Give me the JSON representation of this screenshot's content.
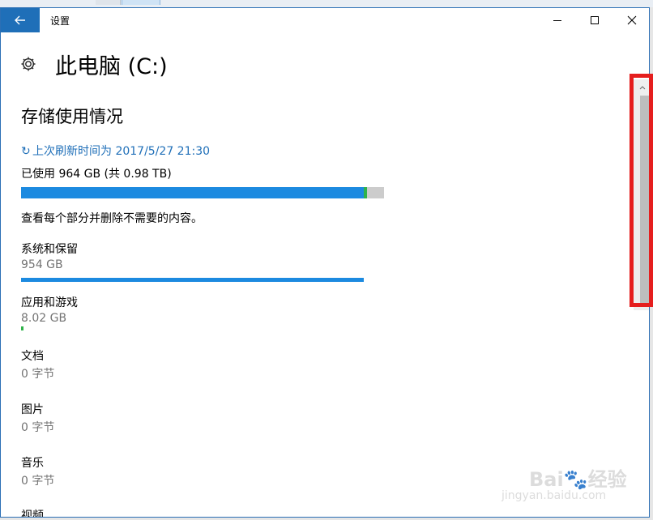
{
  "titlebar": {
    "title": "设置"
  },
  "page": {
    "title": "此电脑 (C:)"
  },
  "storage": {
    "section_title": "存储使用情况",
    "refresh_link": "上次刷新时间为 2017/5/27 21:30",
    "used_summary": "已使用 964 GB (共 0.98 TB)",
    "usage_fraction": 0.98,
    "hint": "查看每个部分并删除不需要的内容。",
    "categories": [
      {
        "name": "系统和保留",
        "size": "954 GB",
        "fraction": 0.944,
        "color": "#1c8ae0"
      },
      {
        "name": "应用和游戏",
        "size": "8.02 GB",
        "fraction": 0.008,
        "color": "#2fb34a"
      },
      {
        "name": "文档",
        "size": "0 字节",
        "fraction": 0
      },
      {
        "name": "图片",
        "size": "0 字节",
        "fraction": 0
      },
      {
        "name": "音乐",
        "size": "0 字节",
        "fraction": 0
      },
      {
        "name": "视频"
      }
    ]
  },
  "icons": {
    "back": "back-arrow-icon",
    "gear": "gear-icon",
    "refresh": "refresh-icon",
    "minimize": "minimize-icon",
    "maximize": "maximize-icon",
    "close": "close-icon",
    "scroll_up": "chevron-up-icon"
  },
  "watermark": {
    "brand": "Bai",
    "brand_cn": "经验",
    "url": "jingyan.baidu.com"
  },
  "colors": {
    "accent": "#1f6fb8",
    "system_bar": "#1c8ae0",
    "apps_bar": "#2fb34a",
    "highlight": "#e51e1e"
  }
}
